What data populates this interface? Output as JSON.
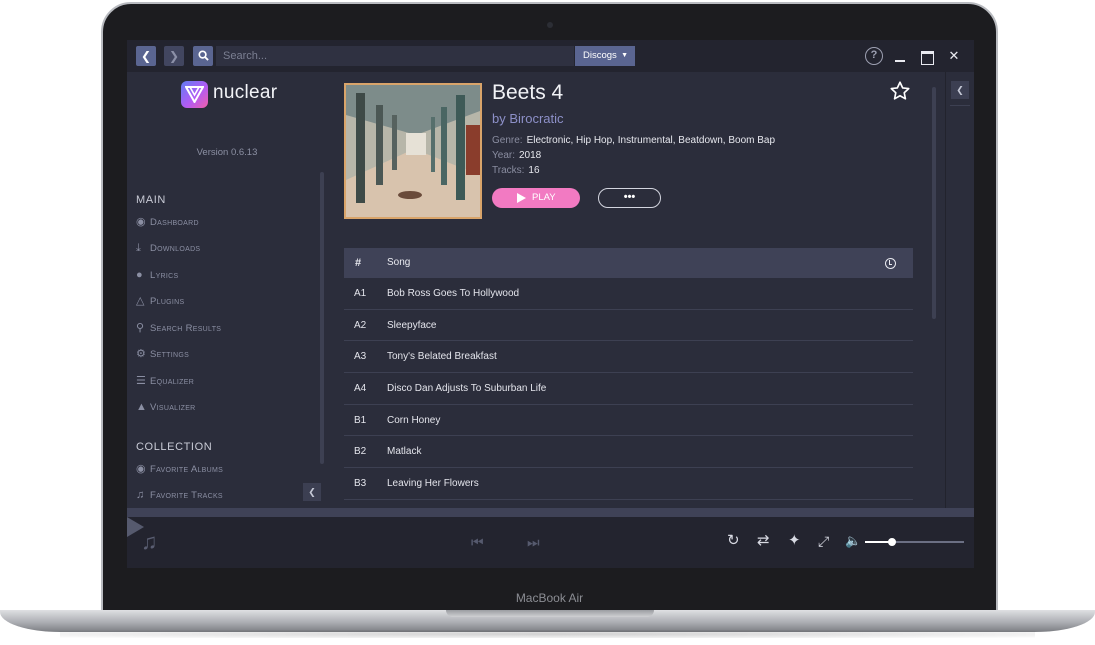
{
  "device": {
    "label": "MacBook Air"
  },
  "topbar": {
    "back_icon": "chevron-left-icon",
    "forward_icon": "chevron-right-icon",
    "search_icon": "search-icon",
    "search_placeholder": "Search...",
    "search_value": "",
    "provider": "Discogs",
    "help_icon": "question-circle-icon"
  },
  "sidebar": {
    "app_name": "nuclear",
    "version": "Version 0.6.13",
    "main_heading": "MAIN",
    "main_items": [
      {
        "label": "Dashboard",
        "icon": "dashboard-icon"
      },
      {
        "label": "Downloads",
        "icon": "download-icon"
      },
      {
        "label": "Lyrics",
        "icon": "microphone-icon"
      },
      {
        "label": "Plugins",
        "icon": "flask-icon"
      },
      {
        "label": "Search Results",
        "icon": "search-icon"
      },
      {
        "label": "Settings",
        "icon": "cogs-icon"
      },
      {
        "label": "Equalizer",
        "icon": "sliders-icon"
      },
      {
        "label": "Visualizer",
        "icon": "tint-icon"
      }
    ],
    "collection_heading": "COLLECTION",
    "collection_items": [
      {
        "label": "Favorite Albums",
        "icon": "record-icon"
      },
      {
        "label": "Favorite Tracks",
        "icon": "music-icon"
      }
    ]
  },
  "album": {
    "title": "Beets 4",
    "artist": "by Birocratic",
    "genre_label": "Genre:",
    "genre": "Electronic, Hip Hop, Instrumental, Beatdown, Boom Bap",
    "year_label": "Year:",
    "year": "2018",
    "tracks_label": "Tracks:",
    "tracks": "16",
    "play_label": "PLAY",
    "more_label": "•••"
  },
  "tracklist": {
    "columns": {
      "number": "#",
      "song": "Song"
    },
    "rows": [
      {
        "num": "A1",
        "title": "Bob Ross Goes To Hollywood"
      },
      {
        "num": "A2",
        "title": "Sleepyface"
      },
      {
        "num": "A3",
        "title": "Tony's Belated Breakfast"
      },
      {
        "num": "A4",
        "title": "Disco Dan Adjusts To Suburban Life"
      },
      {
        "num": "B1",
        "title": "Corn Honey"
      },
      {
        "num": "B2",
        "title": "Matlack"
      },
      {
        "num": "B3",
        "title": "Leaving Her Flowers"
      }
    ]
  },
  "player": {
    "volume": 0.27,
    "colors": {
      "accent": "#f27ac2",
      "primary": "#5a6591",
      "background": "#2b2d3b"
    }
  }
}
